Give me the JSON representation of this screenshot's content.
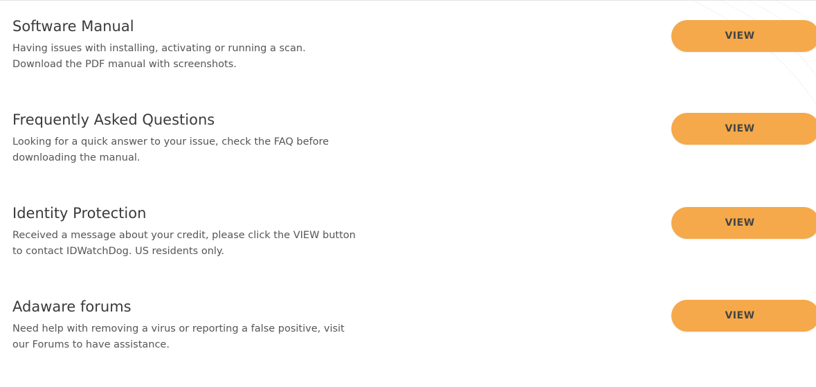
{
  "colors": {
    "button_bg": "#f5a94a",
    "title_text": "#3a3a3a",
    "desc_text": "#555555"
  },
  "items": [
    {
      "title": "Software Manual",
      "desc_line1": "Having issues with installing, activating or running a scan.",
      "desc_line2": "Download the PDF manual with screenshots.",
      "button_label": "VIEW"
    },
    {
      "title": "Frequently Asked Questions",
      "desc_line1": "Looking for a quick answer to your issue, check the FAQ before",
      "desc_line2": "downloading the manual.",
      "button_label": "VIEW"
    },
    {
      "title": "Identity Protection",
      "desc_line1": "Received a message about your credit, please click the VIEW button",
      "desc_line2": "to contact IDWatchDog. US residents only.",
      "button_label": "VIEW"
    },
    {
      "title": "Adaware forums",
      "desc_line1": "Need help with removing a virus or reporting a false positive, visit",
      "desc_line2": "our Forums to have assistance.",
      "button_label": "VIEW"
    }
  ]
}
